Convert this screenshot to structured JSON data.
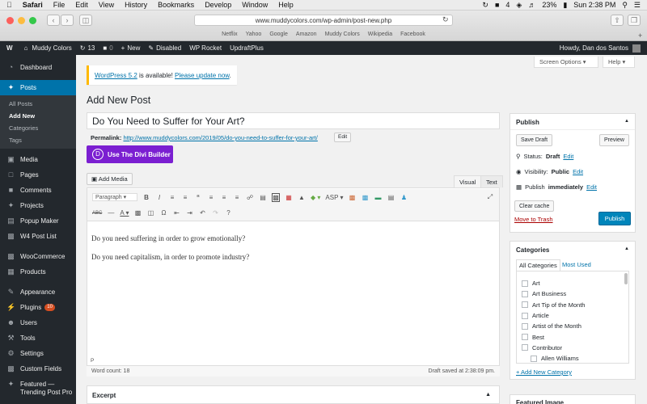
{
  "mac_menubar": {
    "apple": "",
    "app": "Safari",
    "menus": [
      "File",
      "Edit",
      "View",
      "History",
      "Bookmarks",
      "Develop",
      "Window",
      "Help"
    ],
    "battery": "23%",
    "clock": "Sun 2:38 PM",
    "badge_num": "4"
  },
  "safari": {
    "url": "www.muddycolors.com/wp-admin/post-new.php",
    "bookmarks": [
      "Netflix",
      "Yahoo",
      "Google",
      "Amazon",
      "Muddy Colors",
      "Wikipedia",
      "Facebook"
    ]
  },
  "adminbar": {
    "site": "Muddy Colors",
    "updates": "13",
    "comments": "0",
    "new": "New",
    "disabled": "Disabled",
    "rocket": "WP Rocket",
    "updraft": "UpdraftPlus",
    "howdy": "Howdy, Dan dos Santos"
  },
  "sidebar": {
    "dashboard": "Dashboard",
    "posts": "Posts",
    "sub": [
      "All Posts",
      "Add New",
      "Categories",
      "Tags"
    ],
    "items": [
      "Media",
      "Pages",
      "Comments",
      "Projects",
      "Popup Maker",
      "W4 Post List"
    ],
    "items2": [
      "WooCommerce",
      "Products"
    ],
    "items3": [
      "Appearance",
      "Plugins",
      "Users",
      "Tools",
      "Settings",
      "Custom Fields"
    ],
    "plugins_badge": "10",
    "featured": "Featured —",
    "trending": "Trending Post Pro"
  },
  "screen_options": "Screen Options ▾",
  "help": "Help ▾",
  "notice": {
    "pre": "WordPress 5.2",
    "mid": " is available! ",
    "link": "Please update now",
    "post": "."
  },
  "heading": "Add New Post",
  "post_title": "Do You Need to Suffer for Your Art?",
  "permalink": {
    "label": "Permalink:",
    "url": "http://www.muddycolors.com/2019/05/do-you-need-to-suffer-for-your-art/",
    "edit": "Edit"
  },
  "divi": {
    "d": "D",
    "label": "Use The Divi Builder"
  },
  "add_media": "Add Media",
  "tabs": {
    "visual": "Visual",
    "text": "Text"
  },
  "toolbar": {
    "format": "Paragraph",
    "asp": "ASP"
  },
  "content": [
    "Do you need suffering in order to grow emotionally?",
    "Do you need capitalism, in order to promote industry?"
  ],
  "path": "P",
  "word_count": "Word count: 18",
  "draft_saved": "Draft saved at 2:38:09 pm.",
  "excerpt": "Excerpt",
  "publish": {
    "title": "Publish",
    "save_draft": "Save Draft",
    "preview": "Preview",
    "status_label": "Status:",
    "status": "Draft",
    "status_edit": "Edit",
    "vis_label": "Visibility:",
    "vis": "Public",
    "vis_edit": "Edit",
    "pub_label": "Publish",
    "pub": "immediately",
    "pub_edit": "Edit",
    "clear_cache": "Clear cache",
    "trash": "Move to Trash",
    "publish_btn": "Publish"
  },
  "categories": {
    "title": "Categories",
    "tab_all": "All Categories",
    "tab_most": "Most Used",
    "list": [
      "Art",
      "Art Business",
      "Art Tip of the Month",
      "Article",
      "Artist of the Month",
      "Best",
      "Contributor"
    ],
    "child": "Allen Williams",
    "add": "+ Add New Category"
  },
  "featured_image": "Featured Image"
}
